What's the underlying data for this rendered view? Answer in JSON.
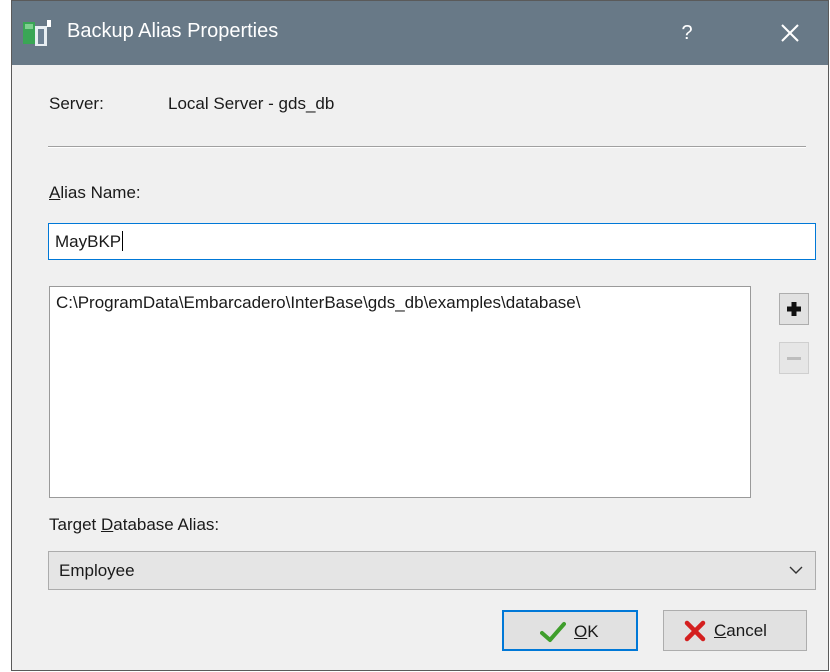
{
  "window": {
    "title": "Backup Alias Properties",
    "help_label": "?"
  },
  "server": {
    "label": "Server:",
    "value": "Local Server - gds_db"
  },
  "alias_name": {
    "label_accel": "A",
    "label_rest": "lias Name:",
    "value": "MayBKP"
  },
  "files": {
    "items": [
      "C:\\ProgramData\\Embarcadero\\InterBase\\gds_db\\examples\\database\\"
    ],
    "add_icon": "plus-icon",
    "remove_icon": "minus-icon"
  },
  "target": {
    "label_before": "Target ",
    "label_accel": "D",
    "label_after": "atabase Alias:",
    "selected": "Employee"
  },
  "buttons": {
    "ok_accel": "O",
    "ok_rest": "K",
    "cancel_accel": "C",
    "cancel_rest": "ancel"
  },
  "colors": {
    "titlebar": "#687987",
    "focus_border": "#0078d7",
    "ok_check": "#3f9e2c",
    "cancel_x": "#d42020"
  }
}
